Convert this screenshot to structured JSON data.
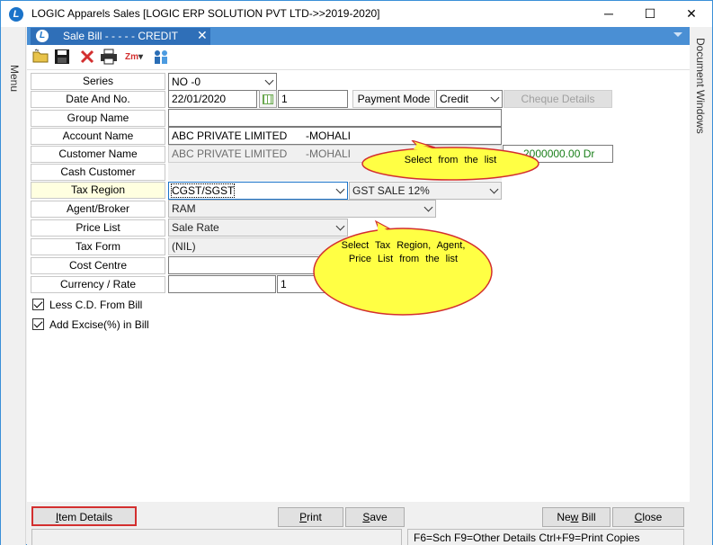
{
  "window": {
    "title": "LOGIC Apparels Sales  [LOGIC ERP SOLUTION PVT LTD->>2019-2020]",
    "minimize": "─",
    "maximize": "☐",
    "close": "✕"
  },
  "rails": {
    "left_label": "Menu",
    "right_label": "Document Windows"
  },
  "doc_tab": {
    "label": "Sale Bill -  - - - - CREDIT",
    "close": "✕"
  },
  "toolbar": {
    "icons": [
      "new-folder-icon",
      "save-disk-icon",
      "delete-x-icon",
      "print-icon",
      "zoom-icon",
      "users-icon"
    ],
    "zoom_label": "Zm"
  },
  "form": {
    "labels": {
      "series": "Series",
      "date_and_no": "Date And No.",
      "group_name": "Group Name",
      "account_name": "Account Name",
      "customer_name": "Customer Name",
      "cash_customer": "Cash Customer",
      "tax_region": "Tax Region",
      "agent_broker": "Agent/Broker",
      "price_list": "Price List",
      "tax_form": "Tax Form",
      "cost_centre": "Cost Centre",
      "currency_rate": "Currency / Rate"
    },
    "values": {
      "series": "NO  -0",
      "date": "22/01/2020",
      "bill_no": "1",
      "payment_mode_label": "Payment Mode",
      "payment_mode": "Credit",
      "cheque_details": "Cheque Details",
      "group_name": "",
      "account_name": "ABC PRIVATE LIMITED",
      "account_city": "-MOHALI",
      "customer_name": "ABC PRIVATE LIMITED",
      "customer_city": "-MOHALI",
      "balance": "2000000.00 Dr",
      "cash_customer": "",
      "tax_region": "CGST/SGST",
      "tax_type": "GST SALE 12%",
      "agent_broker": "RAM",
      "price_list": "Sale Rate",
      "tax_form": "(NIL)",
      "cost_centre": "",
      "currency": "",
      "rate": "1"
    },
    "checkboxes": [
      {
        "label": "Less C.D. From Bill",
        "checked": true
      },
      {
        "label": "Add Excise(%) in Bill",
        "checked": true
      }
    ]
  },
  "callouts": {
    "select_list": "Select  from  the  list",
    "select_tax": "Select  Tax  Region, Agent,  Price  List  from the  list"
  },
  "buttons": {
    "item_details": "Item Details",
    "print": "Print",
    "save": "Save",
    "new_bill": "New Bill",
    "close": "Close"
  },
  "status": {
    "hotkeys": "F6=Sch  F9=Other Details  Ctrl+F9=Print Copies"
  },
  "colors": {
    "tab_blue": "#2f6fb8",
    "callout_fill": "#ffff44",
    "callout_border": "#d32f2f",
    "balance_green": "#1a7f1a",
    "highlight_red": "#d32f2f"
  }
}
